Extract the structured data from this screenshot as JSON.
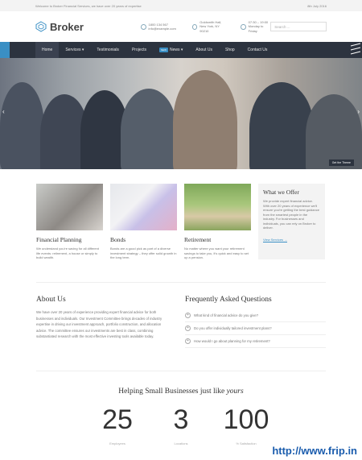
{
  "topbar": {
    "welcome": "Welcome to Broker Financial Services, we have over 20 years of expertise",
    "date": "8th July 2016"
  },
  "header": {
    "logo_text": "Broker",
    "phone": "1800 134 567",
    "email": "info@example.com",
    "address1": "Goldsmith Hall,",
    "address2": "New York, NY 90210",
    "hours1": "07:30 – 19:00",
    "hours2": "Monday to Friday",
    "search_placeholder": "Search ..."
  },
  "nav": {
    "items": [
      {
        "label": "Home"
      },
      {
        "label": "Services ▾"
      },
      {
        "label": "Testimonials"
      },
      {
        "label": "Projects"
      },
      {
        "label": "News ▾",
        "badge": "NEW"
      },
      {
        "label": "About Us"
      },
      {
        "label": "Shop"
      },
      {
        "label": "Contact Us"
      }
    ]
  },
  "hero": {
    "button": "Get the Theme",
    "prev": "‹",
    "next": "›"
  },
  "services": [
    {
      "title": "Financial Planning",
      "text": "We understand you're saving for all different life events: retirement, a house or simply to build wealth."
    },
    {
      "title": "Bonds",
      "text": "Bonds are a good pick as part of a diverse investment strategy – they offer solid growth in the long term."
    },
    {
      "title": "Retirement",
      "text": "No matter where you want your retirement savings to take you, it's quick and easy to set up a pension."
    }
  ],
  "offer": {
    "title": "What we Offer",
    "text": "We provide expert financial advice. With over 20 years of experience we'll ensure you're getting the best guidance from the smartest people in the industry. For businesses and individuals, you can rely on Broker to deliver.",
    "link": "View Services →"
  },
  "about": {
    "title": "About Us",
    "text": "We have over 20 years of experience providing expert financial advice for both businesses and individuals. Our Investment Committee brings decades of industry expertise in driving our investment approach, portfolio construction, and allocation advice. The committee ensures our investments are best in class, combining substantiated research with the most effective investing tools available today."
  },
  "faq": {
    "title": "Frequently Asked Questions",
    "items": [
      {
        "q": "What kind of financial advice do you give?"
      },
      {
        "q": "Do you offer individually tailored investment plans?"
      },
      {
        "q": "How would I go about planning for my retirement?"
      }
    ]
  },
  "helping": {
    "text": "Helping Small Businesses just like ",
    "emph": "yours"
  },
  "stats": [
    {
      "num": "25",
      "label": "Employees"
    },
    {
      "num": "3",
      "label": "Locations"
    },
    {
      "num": "100",
      "label": "% Satisfaction"
    }
  ],
  "watermark": "http://www.frip.in"
}
